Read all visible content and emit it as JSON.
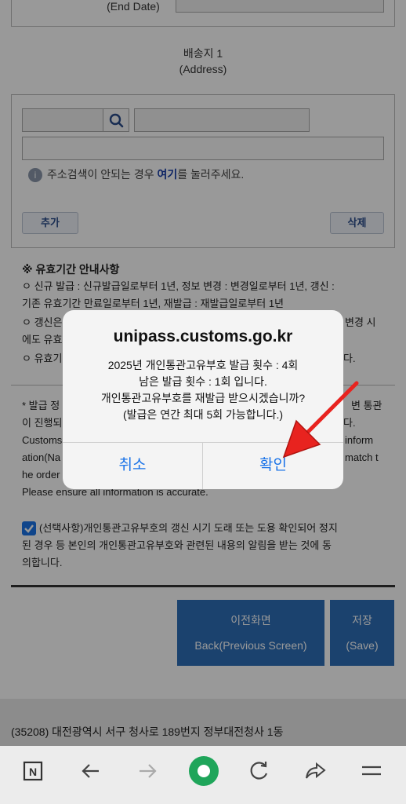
{
  "form": {
    "end_date_label": "(End Date)",
    "address_title": "배송지 1",
    "address_subtitle": "(Address)",
    "address_help_prefix": "주소검색이 안되는 경우 ",
    "address_help_link": "여기",
    "address_help_suffix": "를 눌러주세요.",
    "add_label": "추가",
    "delete_label": "삭제"
  },
  "notice": {
    "heading": "※ 유효기간 안내사항",
    "line1": "ㅇ 신규 발급 : 신규발급일로부터 1년, 정보 변경 : 변경일로부터 1년, 갱신 :",
    "line2": "기존 유효기간 만료일로부터 1년, 재발급 : 재발급일로부터 1년",
    "line3": "ㅇ 갱신은",
    "line3b": "변경 시",
    "line4": "에도 유효",
    "line5": "ㅇ 유효기",
    "line5b": "다."
  },
  "info": {
    "line1": "* 발급 정",
    "line1b": "변 통관",
    "line2": "이 진행되",
    "line2b": "다.",
    "line3": "Customs",
    "line3b": "inform",
    "line4": "ation(Na",
    "line4b": "match t",
    "line5": "he order",
    "line6": "Please ensure all information is accurate."
  },
  "consent": {
    "checked": true,
    "line1": "(선택사항)개인통관고유부호의 갱신 시기 도래 또는 도용 확인되어 정지",
    "line2": "된 경우 등 본인의 개인통관고유부호와 관련된 내용의 알림을 받는 것에 동",
    "line3": "의합니다."
  },
  "actions": {
    "back_ko": "이전화면",
    "back_en": "Back(Previous Screen)",
    "save_ko": "저장",
    "save_en": "(Save)"
  },
  "footer": {
    "address": "(35208) 대전광역시 서구 청사로 189번지 정부대전청사 1동"
  },
  "dialog": {
    "title": "unipass.customs.go.kr",
    "line1": "2025년 개인통관고유부호 발급 횟수 : 4회",
    "line2": "남은 발급 횟수 : 1회 입니다.",
    "line3": "개인통관고유부호를 재발급 받으시겠습니까?",
    "line4": "(발급은 연간 최대 5회 가능합니다.)",
    "cancel_label": "취소",
    "confirm_label": "확인"
  },
  "colors": {
    "accent": "#1a73e8",
    "primary_button": "#2e6fb8",
    "arrow": "#e8231f"
  },
  "toolbar": {
    "icons": [
      "naver-n-icon",
      "back-arrow-icon",
      "forward-arrow-icon",
      "home-circle-icon",
      "refresh-icon",
      "share-icon",
      "menu-icon"
    ]
  }
}
